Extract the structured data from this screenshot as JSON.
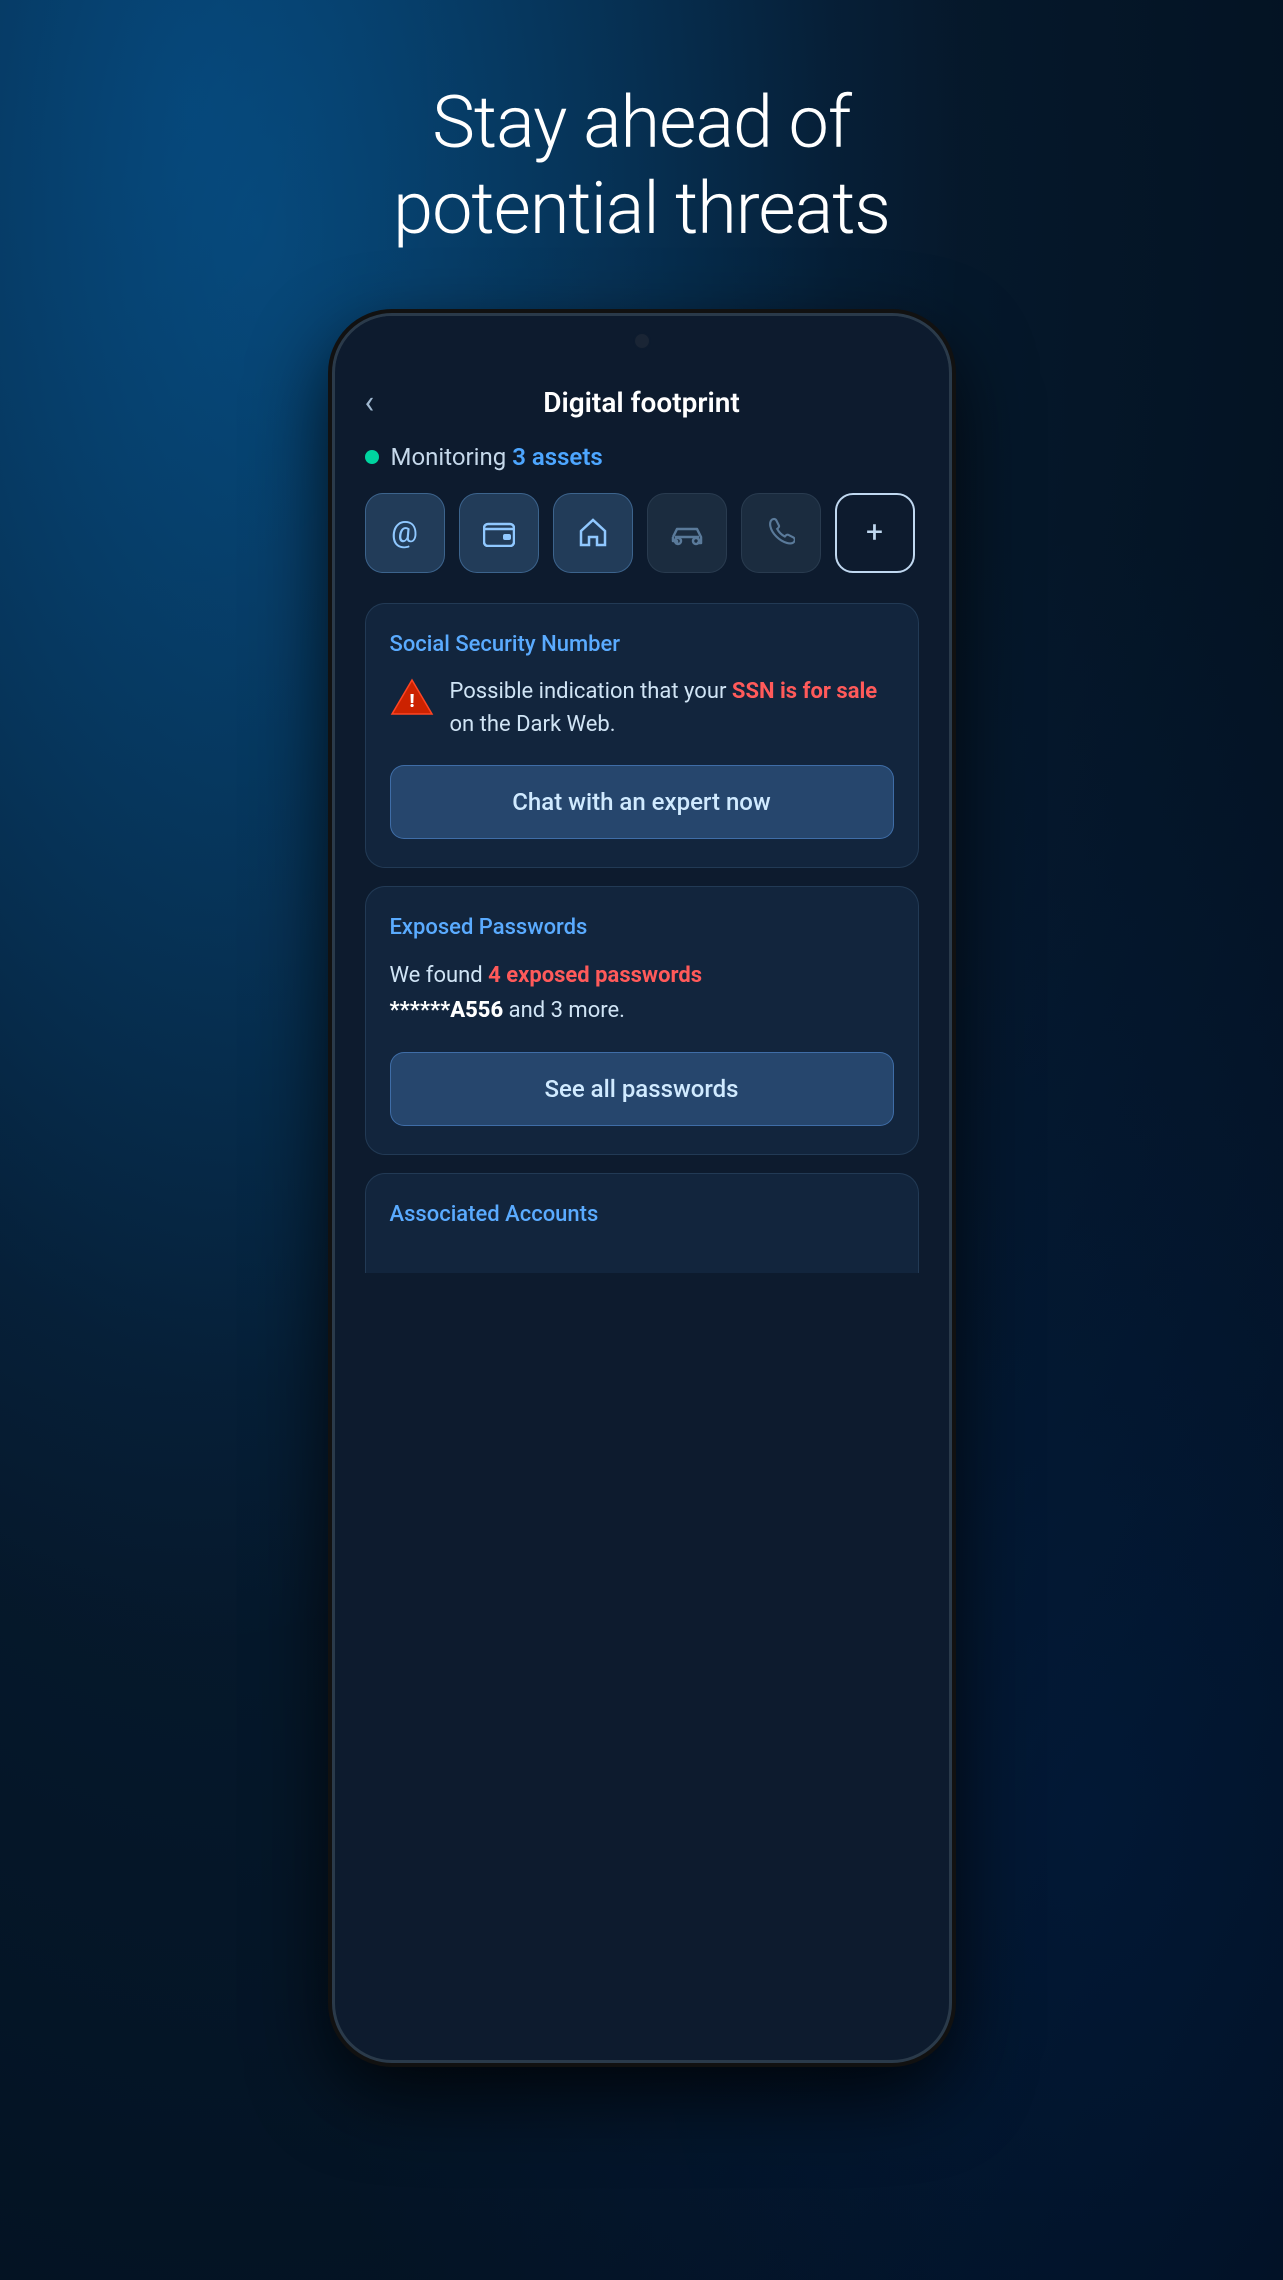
{
  "page": {
    "headline_line1": "Stay ahead of",
    "headline_line2": "potential threats"
  },
  "header": {
    "back_label": "‹",
    "title": "Digital footprint"
  },
  "monitoring": {
    "label": "Monitoring",
    "assets_count": "3 assets"
  },
  "icons": [
    {
      "id": "email-icon",
      "symbol": "@",
      "state": "active"
    },
    {
      "id": "wallet-icon",
      "symbol": "▣",
      "state": "active"
    },
    {
      "id": "home-icon",
      "symbol": "⌂",
      "state": "active"
    },
    {
      "id": "car-icon",
      "symbol": "🚗",
      "state": "inactive"
    },
    {
      "id": "phone-icon",
      "symbol": "✆",
      "state": "inactive"
    },
    {
      "id": "add-icon",
      "symbol": "+",
      "state": "add"
    }
  ],
  "ssn_card": {
    "title": "Social Security Number",
    "alert_text_prefix": "Possible indication that your",
    "alert_highlight": "SSN is for sale",
    "alert_text_suffix": "on the Dark Web.",
    "button_label": "Chat with an expert now"
  },
  "passwords_card": {
    "title": "Exposed Passwords",
    "text_prefix": "We found",
    "highlight": "4 exposed passwords",
    "text_suffix": "******A556 and 3 more.",
    "password_masked": "******",
    "password_visible": "A556",
    "button_label": "See all passwords"
  },
  "accounts_card": {
    "title": "Associated Accounts"
  }
}
